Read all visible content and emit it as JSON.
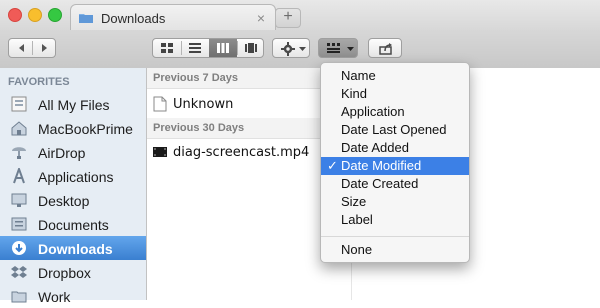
{
  "window": {
    "tab_title": "Downloads",
    "tab_close": "×",
    "new_tab": "+"
  },
  "sidebar": {
    "header": "FAVORITES",
    "items": [
      {
        "label": "All My Files",
        "icon": "all-files-icon"
      },
      {
        "label": "MacBookPrime",
        "icon": "home-icon"
      },
      {
        "label": "AirDrop",
        "icon": "airdrop-icon"
      },
      {
        "label": "Applications",
        "icon": "applications-icon"
      },
      {
        "label": "Desktop",
        "icon": "desktop-icon"
      },
      {
        "label": "Documents",
        "icon": "documents-icon"
      },
      {
        "label": "Downloads",
        "icon": "downloads-icon",
        "selected": true
      },
      {
        "label": "Dropbox",
        "icon": "dropbox-icon"
      },
      {
        "label": "Work",
        "icon": "folder-icon"
      }
    ]
  },
  "main": {
    "groups": [
      {
        "label": "Previous 7 Days",
        "files": [
          {
            "name": "Unknown",
            "icon": "document-icon"
          }
        ]
      },
      {
        "label": "Previous 30 Days",
        "files": [
          {
            "name": "diag-screencast.mp4",
            "icon": "video-file-icon"
          }
        ]
      }
    ]
  },
  "arrange_menu": {
    "items": [
      "Name",
      "Kind",
      "Application",
      "Date Last Opened",
      "Date Added",
      "Date Modified",
      "Date Created",
      "Size",
      "Label"
    ],
    "checked_item": "Date Modified",
    "check_mark": "✓",
    "footer_item": "None"
  },
  "colors": {
    "selection_blue": "#3c80e6",
    "sidebar_bg": "#e6edf4"
  }
}
